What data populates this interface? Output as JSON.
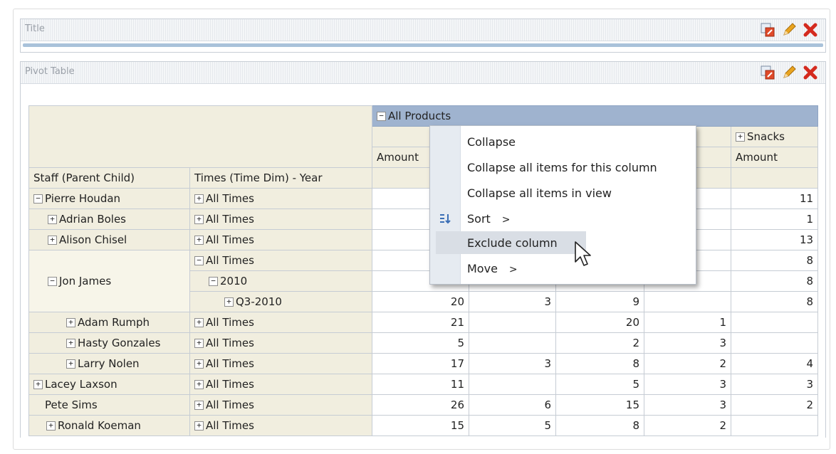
{
  "title_view": {
    "label": "Title"
  },
  "pivot_view": {
    "label": "Pivot Table"
  },
  "columns": {
    "all_products": "All Products",
    "snacks": "Snacks",
    "amount": "Amount",
    "staff_header": "Staff (Parent Child)",
    "times_header": "Times (Time Dim) - Year"
  },
  "rows": [
    {
      "staff": "Pierre Houdan",
      "times": "All Times",
      "v1": "",
      "v2": "",
      "v3": "",
      "v4": "",
      "v5": "11"
    },
    {
      "staff": "Adrian Boles",
      "times": "All Times",
      "v1": "",
      "v2": "",
      "v3": "",
      "v4": "",
      "v5": "1"
    },
    {
      "staff": "Alison Chisel",
      "times": "All Times",
      "v1": "",
      "v2": "",
      "v3": "",
      "v4": "",
      "v5": "13"
    },
    {
      "staff": "Jon James",
      "times": "All Times",
      "v1": "",
      "v2": "",
      "v3": "",
      "v4": "",
      "v5": "8"
    },
    {
      "staff": "",
      "times": "2010",
      "v1": "",
      "v2": "",
      "v3": "",
      "v4": "",
      "v5": "8"
    },
    {
      "staff": "",
      "times": "Q3-2010",
      "v1": "20",
      "v2": "3",
      "v3": "9",
      "v4": "",
      "v5": "8"
    },
    {
      "staff": "Adam Rumph",
      "times": "All Times",
      "v1": "21",
      "v2": "",
      "v3": "20",
      "v4": "1",
      "v5": ""
    },
    {
      "staff": "Hasty Gonzales",
      "times": "All Times",
      "v1": "5",
      "v2": "",
      "v3": "2",
      "v4": "3",
      "v5": ""
    },
    {
      "staff": "Larry Nolen",
      "times": "All Times",
      "v1": "17",
      "v2": "3",
      "v3": "8",
      "v4": "2",
      "v5": "4"
    },
    {
      "staff": "Lacey Laxson",
      "times": "All Times",
      "v1": "11",
      "v2": "",
      "v3": "5",
      "v4": "3",
      "v5": "3"
    },
    {
      "staff": "Pete Sims",
      "times": "All Times",
      "v1": "26",
      "v2": "6",
      "v3": "15",
      "v4": "3",
      "v5": "2"
    },
    {
      "staff": "Ronald Koeman",
      "times": "All Times",
      "v1": "15",
      "v2": "5",
      "v3": "8",
      "v4": "2",
      "v5": ""
    }
  ],
  "context_menu": {
    "collapse": "Collapse",
    "collapse_column": "Collapse all items for this column",
    "collapse_view": "Collapse all items in view",
    "sort": "Sort",
    "exclude": "Exclude column",
    "move": "Move",
    "submenu_arrow": ">"
  },
  "icons": {
    "format": "format-view-icon",
    "edit": "edit-pencil-icon",
    "remove": "remove-x-icon",
    "expand": "plus-box-icon",
    "collapse": "minus-box-icon",
    "sort": "sort-icon",
    "cursor": "mouse-pointer-icon"
  },
  "colors": {
    "header_bg": "#f1eedf",
    "column_header_blue": "#9fb3cf",
    "title_rule": "#a9c2da",
    "remove_red": "#d42a1e",
    "pencil_orange": "#e9a420"
  }
}
